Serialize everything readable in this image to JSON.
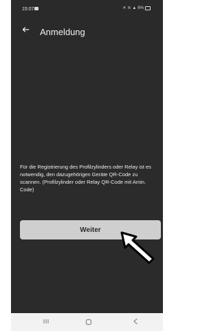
{
  "status_bar": {
    "time": "15:07",
    "right_status_text": "6%"
  },
  "app_bar": {
    "title": "Anmeldung"
  },
  "main": {
    "info_text": "Für die Registrierung des Profilzylinders oder Relay ist es notwendig, den dazugehörigen Geräte QR-Code zu scannen. (Profilzylinder oder Relay QR-Code mit Amin. Code)",
    "weiter_label": "Weiter"
  },
  "icons": {
    "back": "arrow-left-icon",
    "pointer": "cursor-arrow-icon",
    "nav_recent": "recent-apps-icon",
    "nav_home": "home-icon",
    "nav_back": "chevron-left-icon"
  },
  "colors": {
    "screen_bg": "#2b2b2b",
    "button_bg": "#cfcfcf",
    "button_text": "#2b2b2b",
    "text": "#ececec"
  }
}
